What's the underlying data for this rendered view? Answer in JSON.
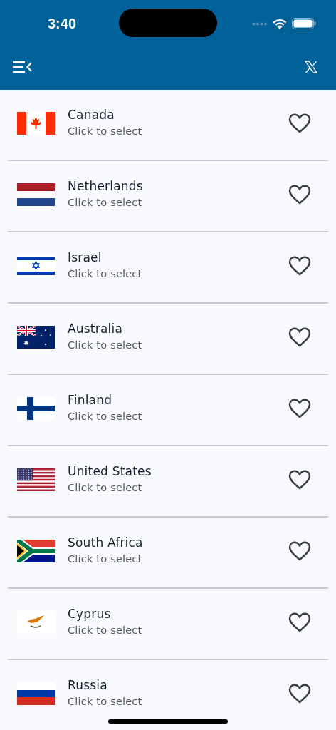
{
  "status_bar": {
    "time": "3:40"
  },
  "countries": [
    {
      "name": "Canada",
      "subtitle": "Click to select",
      "kind": "canada",
      "favorite": false
    },
    {
      "name": "Netherlands",
      "subtitle": "Click to select",
      "kind": "netherlands",
      "favorite": false
    },
    {
      "name": "Israel",
      "subtitle": "Click to select",
      "kind": "israel",
      "favorite": false
    },
    {
      "name": "Australia",
      "subtitle": "Click to select",
      "kind": "australia",
      "favorite": false
    },
    {
      "name": "Finland",
      "subtitle": "Click to select",
      "kind": "finland",
      "favorite": false
    },
    {
      "name": "United States",
      "subtitle": "Click to select",
      "kind": "usa",
      "favorite": false
    },
    {
      "name": "South Africa",
      "subtitle": "Click to select",
      "kind": "southafrica",
      "favorite": false
    },
    {
      "name": "Cyprus",
      "subtitle": "Click to select",
      "kind": "cyprus",
      "favorite": false
    },
    {
      "name": "Russia",
      "subtitle": "Click to select",
      "kind": "russia",
      "favorite": false
    }
  ]
}
